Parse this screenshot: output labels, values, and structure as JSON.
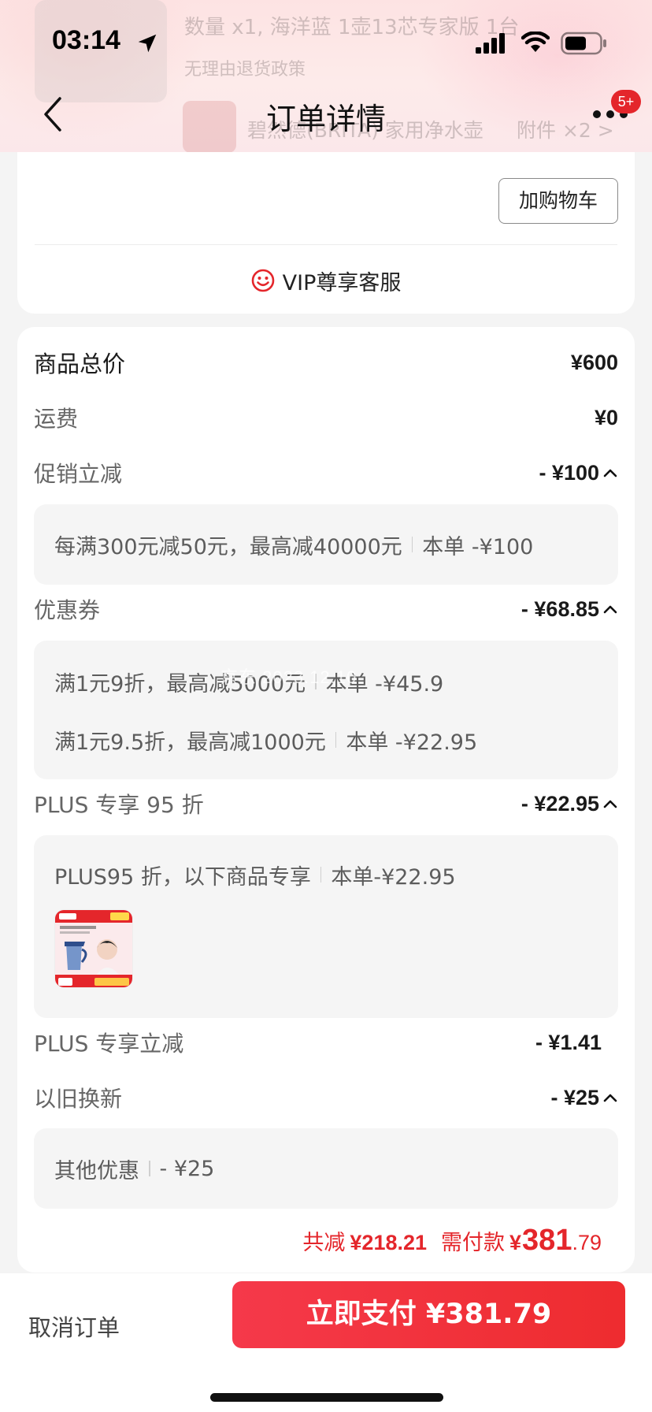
{
  "status_bar": {
    "time": "03:14"
  },
  "header": {
    "title": "订单详情",
    "more_badge": "5+",
    "ghost_lines": [
      "数量 x1, 海洋蓝 1壶13芯专家版 1台",
      "无理由退货政策",
      "碧然德(BRITA) 家用净水壶",
      "附件 ×2 >"
    ]
  },
  "order_card": {
    "add_to_cart": "加购物车",
    "vip_service": "VIP尊享客服"
  },
  "price_detail": {
    "goods_total": {
      "label": "商品总价",
      "value": "¥600"
    },
    "shipping": {
      "label": "运费",
      "value": "¥0"
    },
    "promotion": {
      "label": "促销立减",
      "value": "- ¥100",
      "details": [
        {
          "rule": "每满300元减50元，最高减40000元",
          "amount": "本单 -¥100"
        }
      ]
    },
    "coupon": {
      "label": "优惠券",
      "value": "- ¥68.85",
      "details": [
        {
          "rule": "满1元9折，最高减5000元",
          "amount": "本单 -¥45.9"
        },
        {
          "rule": "满1元9.5折，最高减1000元",
          "amount": "本单 -¥22.95"
        }
      ]
    },
    "plus_discount": {
      "label": "PLUS 专享 95 折",
      "value": "- ¥22.95",
      "details": [
        {
          "rule": "PLUS95 折，以下商品专享",
          "amount": "本单-¥22.95"
        }
      ]
    },
    "plus_reduce": {
      "label": "PLUS 专享立减",
      "value": "- ¥1.41"
    },
    "trade_in": {
      "label": "以旧换新",
      "value": "- ¥25",
      "details": [
        {
          "rule": "其他优惠",
          "amount": "- ¥25"
        }
      ]
    },
    "summary": {
      "total_reduce_label": "共减",
      "total_reduce_value": "¥218.21",
      "need_pay_label": "需付款",
      "need_pay_currency": "¥",
      "need_pay_int": "381",
      "need_pay_dec": ".79"
    }
  },
  "watermark": "京东 2023.12.10",
  "bottom_bar": {
    "cancel_label": "取消订单",
    "pay_label": "立即支付 ¥381.79"
  },
  "colors": {
    "accent_red": "#e4262b",
    "pay_button": "#f03436",
    "header_pink": "#fde3e3"
  }
}
